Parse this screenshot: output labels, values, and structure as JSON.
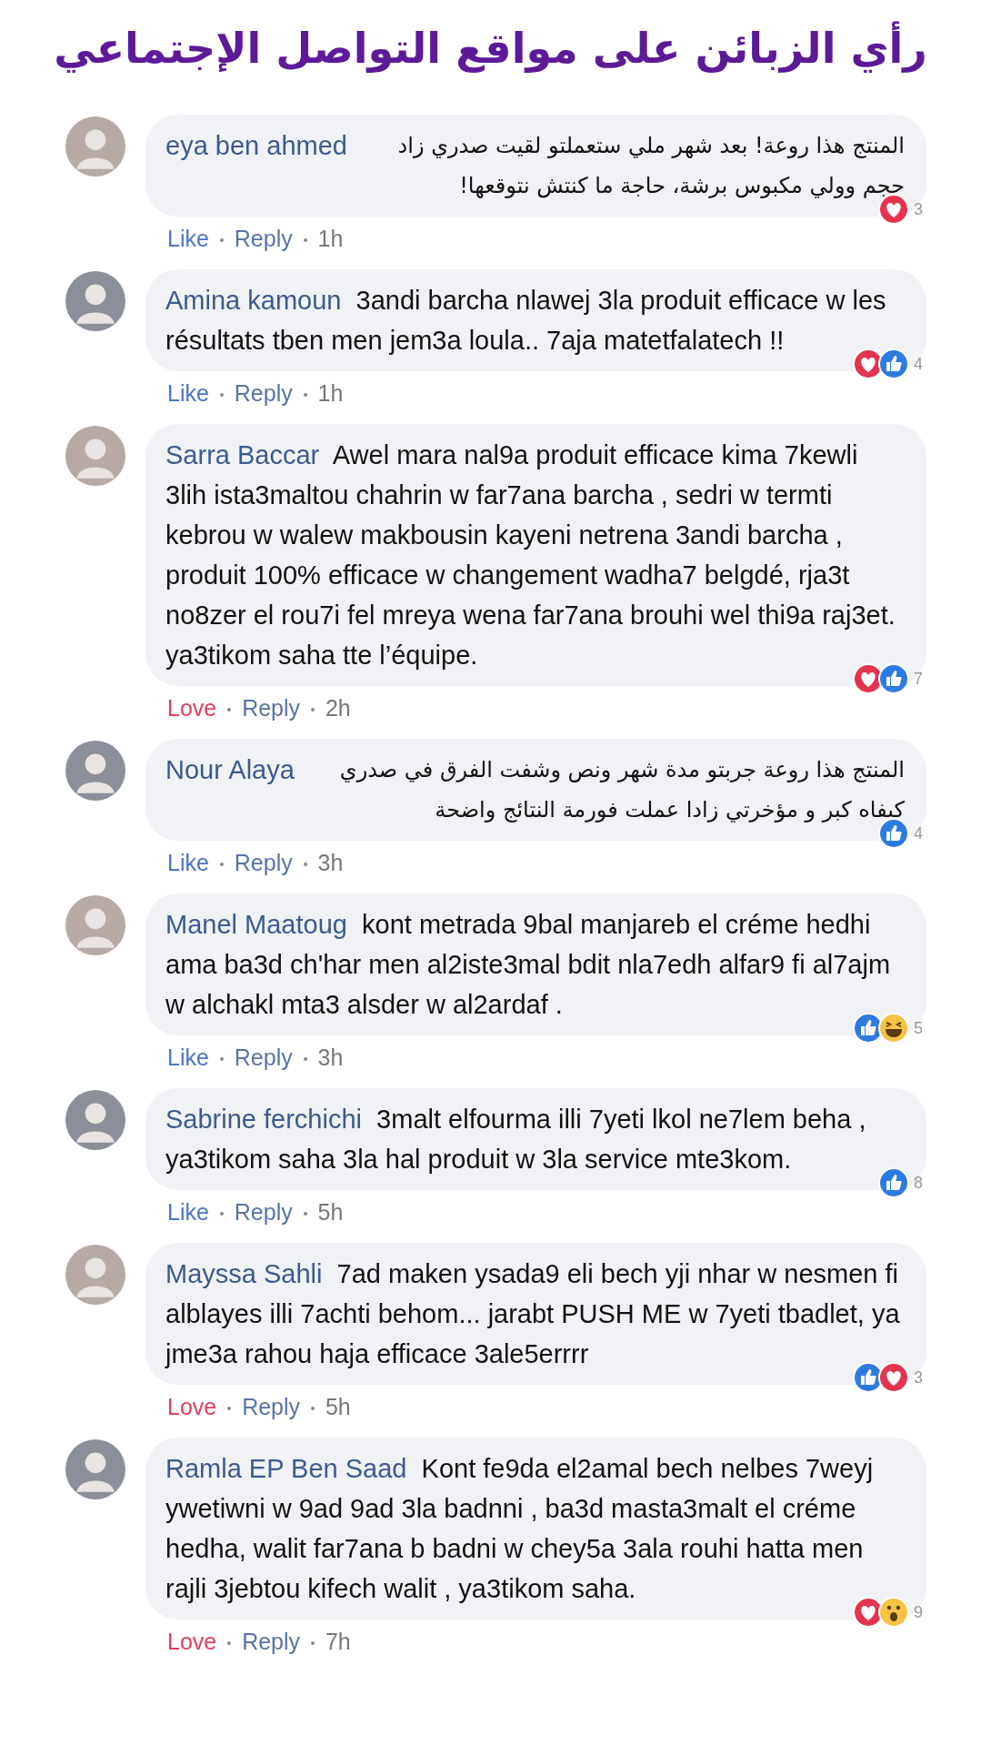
{
  "title": "رأي الزبائن على مواقع التواصل الإجتماعي",
  "comments": [
    {
      "author": "eya ben ahmed",
      "rtl": true,
      "text": "المنتج هذا روعة! بعد شهر ملي ستعملتو لقيت صدري زاد حجم وولي مكبوس برشة، حاجة ما كنتش نتوقعها!",
      "reactions": [
        {
          "kind": "love"
        }
      ],
      "count": "3",
      "action": {
        "kind": "like",
        "label": "Like"
      },
      "reply": "Reply",
      "time": "1h"
    },
    {
      "author": "Amina kamoun",
      "rtl": false,
      "text": "3andi barcha nlawej 3la produit efficace w les résultats tben men jem3a loula.. 7aja matetfalatech !!",
      "reactions": [
        {
          "kind": "love"
        },
        {
          "kind": "like"
        }
      ],
      "count": "4",
      "action": {
        "kind": "like",
        "label": "Like"
      },
      "reply": "Reply",
      "time": "1h"
    },
    {
      "author": "Sarra Baccar",
      "rtl": false,
      "text": "Awel mara nal9a produit efficace kima 7kewli 3lih ista3maltou chahrin w far7ana barcha , sedri w termti kebrou w walew makbousin kayeni netrena 3andi barcha , produit 100% efficace w changement wadha7 belgdé, rja3t no8zer el rou7i fel mreya wena far7ana brouhi wel thi9a raj3et. ya3tikom saha tte l’équipe.",
      "reactions": [
        {
          "kind": "love"
        },
        {
          "kind": "like"
        }
      ],
      "count": "7",
      "action": {
        "kind": "love",
        "label": "Love"
      },
      "reply": "Reply",
      "time": "2h"
    },
    {
      "author": "Nour Alaya",
      "rtl": true,
      "text": "المنتج هذا روعة جربتو مدة شهر ونص وشفت الفرق في صدري كيفاه كبر و مؤخرتي زادا عملت فورمة النتائج واضحة",
      "reactions": [
        {
          "kind": "like"
        }
      ],
      "count": "4",
      "action": {
        "kind": "like",
        "label": "Like"
      },
      "reply": "Reply",
      "time": "3h"
    },
    {
      "author": "Manel Maatoug",
      "rtl": false,
      "text": "kont metrada 9bal manjareb el créme hedhi ama ba3d ch'har men al2iste3mal bdit nla7edh alfar9 fi al7ajm w alchakl mta3 alsder w al2ardaf .",
      "reactions": [
        {
          "kind": "like"
        },
        {
          "kind": "haha"
        }
      ],
      "count": "5",
      "action": {
        "kind": "like",
        "label": "Like"
      },
      "reply": "Reply",
      "time": "3h"
    },
    {
      "author": "Sabrine ferchichi",
      "rtl": false,
      "text": "3malt elfourma illi 7yeti lkol ne7lem beha , ya3tikom saha 3la hal produit w 3la service mte3kom.",
      "reactions": [
        {
          "kind": "like"
        }
      ],
      "count": "8",
      "action": {
        "kind": "like",
        "label": "Like"
      },
      "reply": "Reply",
      "time": "5h"
    },
    {
      "author": "Mayssa Sahli",
      "rtl": false,
      "text": "7ad maken ysada9 eli bech yji nhar w nesmen fi alblayes illi 7achti behom... jarabt PUSH ME w 7yeti tbadlet, ya jme3a rahou haja efficace 3ale5errrr",
      "reactions": [
        {
          "kind": "like"
        },
        {
          "kind": "love"
        }
      ],
      "count": "3",
      "action": {
        "kind": "love",
        "label": "Love"
      },
      "reply": "Reply",
      "time": "5h"
    },
    {
      "author": "Ramla EP Ben Saad",
      "rtl": false,
      "text": "Kont fe9da el2amal bech nelbes 7weyj ywetiwni w 9ad 9ad 3la badnni , ba3d masta3malt el créme hedha, walit far7ana b badni w chey5a 3ala rouhi hatta men rajli 3jebtou kifech walit , ya3tikom saha.",
      "reactions": [
        {
          "kind": "love"
        },
        {
          "kind": "wow"
        }
      ],
      "count": "9",
      "action": {
        "kind": "love",
        "label": "Love"
      },
      "reply": "Reply",
      "time": "7h"
    }
  ]
}
